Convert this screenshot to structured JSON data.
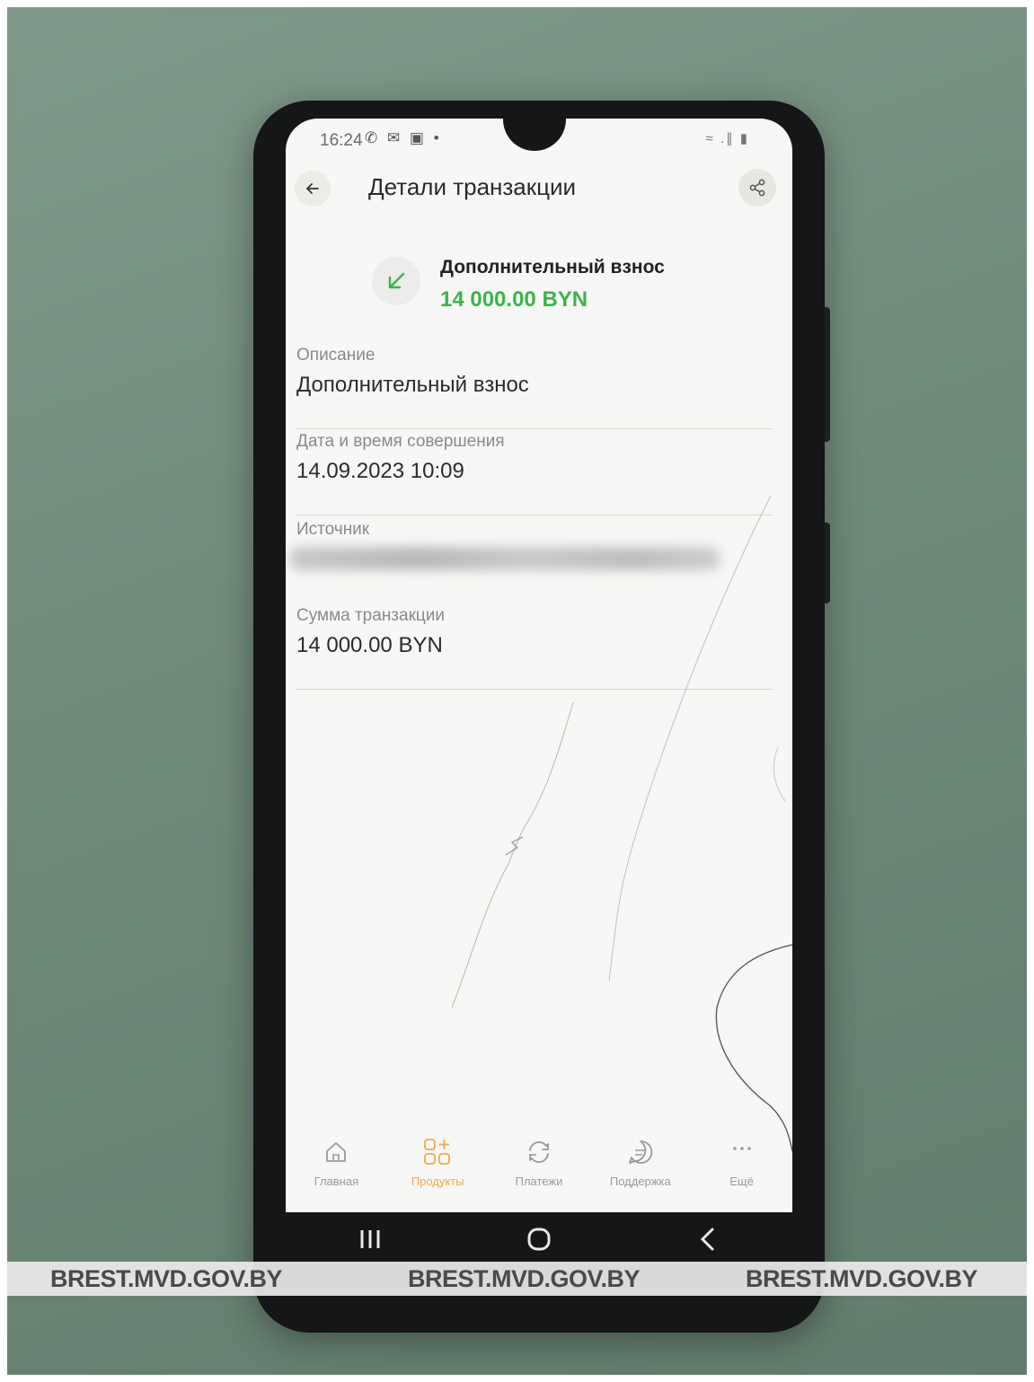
{
  "status_bar": {
    "time": "16:24",
    "left_icons": "✆ ✉ ▣ •",
    "right_icons": "≈ .∥ ▮"
  },
  "header": {
    "title": "Детали транзакции"
  },
  "summary": {
    "title": "Дополнительный взнос",
    "amount": "14 000.00 BYN",
    "amount_color": "#39b54a"
  },
  "fields": [
    {
      "label": "Описание",
      "value": "Дополнительный взнос"
    },
    {
      "label": "Дата и время совершения",
      "value": "14.09.2023 10:09"
    },
    {
      "label": "Источник",
      "value": ""
    },
    {
      "label": "Сумма транзакции",
      "value": "14 000.00 BYN"
    }
  ],
  "bottom_nav": [
    {
      "label": "Главная",
      "icon": "home-icon"
    },
    {
      "label": "Продукты",
      "icon": "products-icon"
    },
    {
      "label": "Платежи",
      "icon": "payments-icon"
    },
    {
      "label": "Поддержка",
      "icon": "support-icon"
    },
    {
      "label": "Ещё",
      "icon": "more-icon"
    }
  ],
  "watermarks": [
    "BREST.MVD.GOV.BY",
    "BREST.MVD.GOV.BY",
    "BREST.MVD.GOV.BY"
  ],
  "colors": {
    "accent_green": "#39b54a",
    "active_nav": "#f0a84a"
  }
}
